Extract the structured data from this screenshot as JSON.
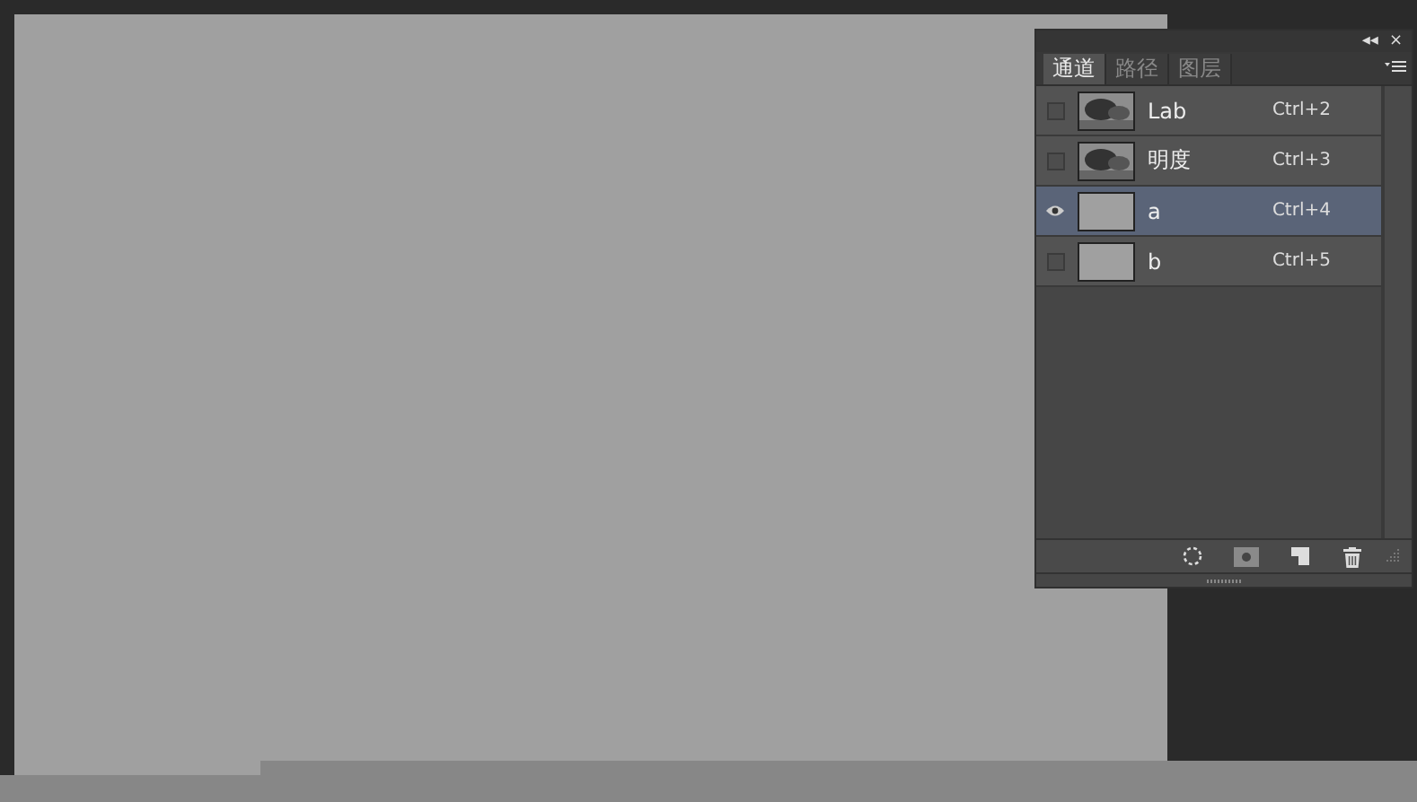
{
  "panel": {
    "collapse_glyph": "◂◂",
    "close_glyph": "×",
    "tabs": [
      {
        "label": "通道",
        "selected": true
      },
      {
        "label": "路径",
        "selected": false
      },
      {
        "label": "图层",
        "selected": false
      }
    ],
    "channels": [
      {
        "name": "Lab",
        "shortcut": "Ctrl+2",
        "visible": false,
        "selected": false,
        "kind": "photo"
      },
      {
        "name": "明度",
        "shortcut": "Ctrl+3",
        "visible": false,
        "selected": false,
        "kind": "photo"
      },
      {
        "name": "a",
        "shortcut": "Ctrl+4",
        "visible": true,
        "selected": true,
        "kind": "flat"
      },
      {
        "name": "b",
        "shortcut": "Ctrl+5",
        "visible": false,
        "selected": false,
        "kind": "flat"
      }
    ]
  }
}
